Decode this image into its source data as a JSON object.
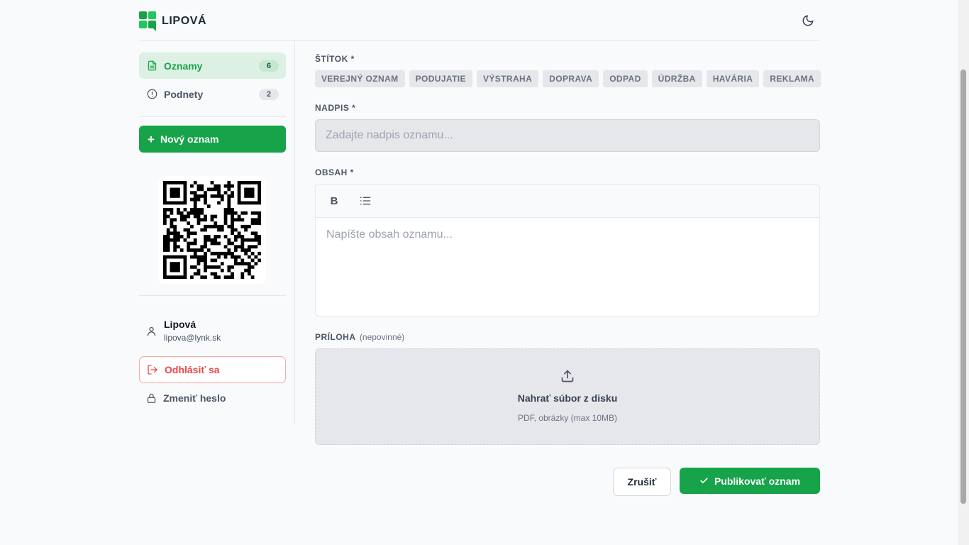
{
  "app": {
    "brand": "LIPOVÁ",
    "brand_color": "#16a34a"
  },
  "sidebar": {
    "items": [
      {
        "label": "Oznamy",
        "count": "6",
        "icon": "document-icon",
        "active": true
      },
      {
        "label": "Podnety",
        "count": "2",
        "icon": "alert-circle-icon",
        "active": false
      }
    ],
    "new_button_label": "Nový oznam",
    "user": {
      "name": "Lipová",
      "email": "lipova@lynk.sk"
    },
    "logout_label": "Odhlásiť sa",
    "change_password_label": "Zmeniť heslo"
  },
  "form": {
    "tag_label": "ŠTÍTOK *",
    "tags": [
      "VEREJNÝ OZNAM",
      "PODUJATIE",
      "VÝSTRAHA",
      "DOPRAVA",
      "ODPAD",
      "ÚDRŽBA",
      "HAVÁRIA",
      "REKLAMA"
    ],
    "title_label": "NADPIS *",
    "title_placeholder": "Zadajte nadpis oznamu...",
    "title_value": "",
    "content_label": "OBSAH *",
    "content_placeholder": "Napíšte obsah oznamu...",
    "toolbar": {
      "bold_label": "B"
    },
    "attachment_label": "PRÍLOHA",
    "attachment_optional": "(nepovinné)",
    "upload_title": "Nahrať súbor z disku",
    "upload_subtitle": "PDF, obrázky (max 10MB)",
    "cancel_label": "Zrušiť",
    "publish_label": "Publikovať oznam"
  },
  "colors": {
    "accent": "#16a34a",
    "danger": "#ef4444"
  }
}
